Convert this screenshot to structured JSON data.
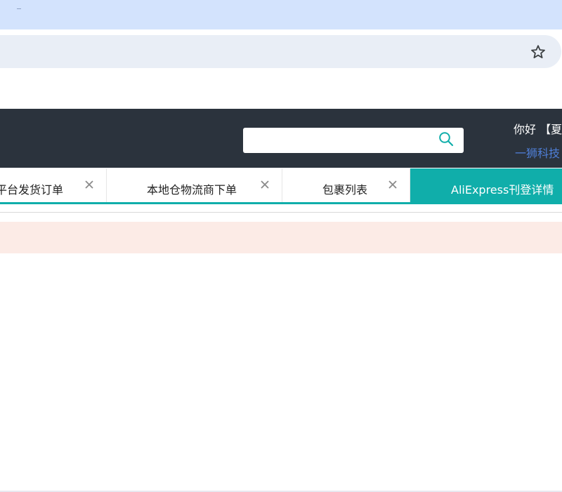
{
  "header": {
    "greeting": "你好 【夏",
    "company": "一狮科技",
    "search_placeholder": ""
  },
  "tabs": [
    {
      "label": "平台发货订单",
      "active": false,
      "closable": true
    },
    {
      "label": "本地仓物流商下单",
      "active": false,
      "closable": true
    },
    {
      "label": "包裹列表",
      "active": false,
      "closable": true
    },
    {
      "label": "AliExpress刊登详情",
      "active": true,
      "closable": false
    }
  ],
  "icons": {
    "bookmark": "star-icon",
    "search": "search-icon",
    "close": "close-icon"
  },
  "colors": {
    "header_bg": "#2b333d",
    "accent": "#10aeaa",
    "link": "#4f7fd8",
    "notice_bg": "#fcebe6",
    "browser_bar": "#d3e3fd",
    "omnibox": "#e9eef6"
  }
}
